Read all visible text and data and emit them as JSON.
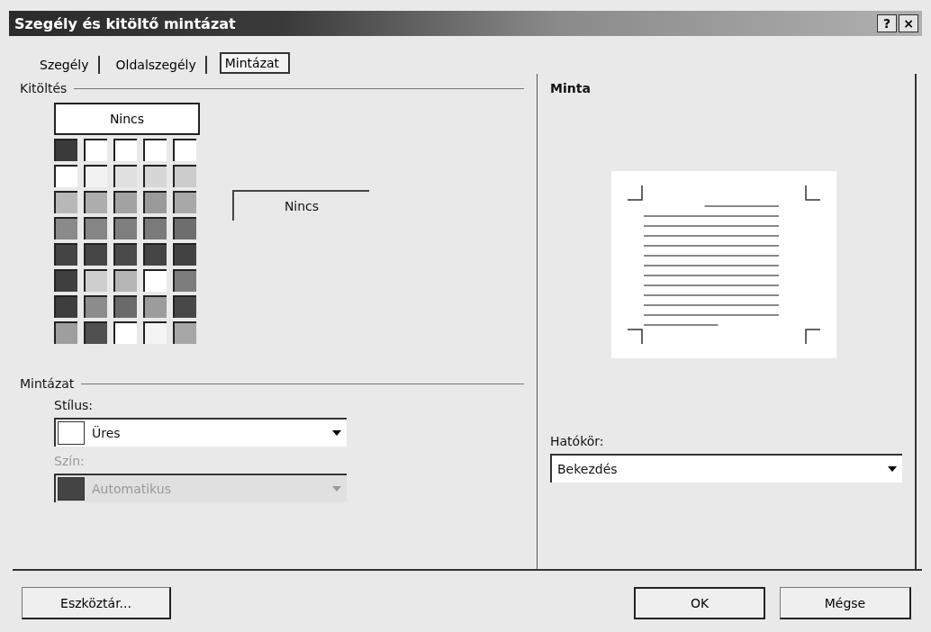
{
  "window": {
    "title": "Szegély és kitöltő mintázat",
    "help_button": "?",
    "close_button": "×"
  },
  "tabs": [
    {
      "label": "Szegély",
      "selected": false
    },
    {
      "label": "Oldalszegély",
      "selected": false
    },
    {
      "label": "Mintázat",
      "selected": true
    }
  ],
  "fill": {
    "label": "Kitöltés",
    "none_button": "Nincs",
    "preview_label": "Nincs",
    "swatches": [
      {
        "color": "#3a3a3a"
      },
      {
        "color": "#ffffff"
      },
      {
        "color": "#ffffff"
      },
      {
        "color": "#ffffff"
      },
      {
        "color": "#ffffff"
      },
      {
        "color": "#ffffff"
      },
      {
        "color": "#f2f2f2"
      },
      {
        "color": "#e0e0e0"
      },
      {
        "color": "#d6d6d6"
      },
      {
        "color": "#cccccc"
      },
      {
        "color": "#b8b8b8"
      },
      {
        "color": "#adadad"
      },
      {
        "color": "#a3a3a3"
      },
      {
        "color": "#9a9a9a"
      },
      {
        "color": "#a8a8a8"
      },
      {
        "color": "#8a8a8a"
      },
      {
        "color": "#858585"
      },
      {
        "color": "#7e7e7e"
      },
      {
        "color": "#7a7a7a"
      },
      {
        "color": "#6e6e6e"
      },
      {
        "color": "#444444"
      },
      {
        "color": "#464646"
      },
      {
        "color": "#4a4a4a"
      },
      {
        "color": "#454545"
      },
      {
        "color": "#424242"
      },
      {
        "color": "#404040"
      },
      {
        "color": "#cfcfcf"
      },
      {
        "color": "#b5b5b5"
      },
      {
        "color": "#ffffff"
      },
      {
        "color": "#7d7d7d"
      },
      {
        "color": "#3e3e3e"
      },
      {
        "color": "#8c8c8c"
      },
      {
        "color": "#6a6a6a"
      },
      {
        "color": "#9c9c9c"
      },
      {
        "color": "#484848"
      },
      {
        "color": "#9e9e9e"
      },
      {
        "color": "#505050"
      },
      {
        "color": "#ffffff"
      },
      {
        "color": "#f4f4f4"
      },
      {
        "color": "#a6a6a6"
      }
    ]
  },
  "pattern": {
    "label": "Mintázat",
    "style": {
      "label": "Stílus:",
      "value": "Üres",
      "disabled": false
    },
    "color": {
      "label": "Szín:",
      "value": "Automatikus",
      "disabled": true
    }
  },
  "preview": {
    "label": "Minta"
  },
  "scope": {
    "label": "Hatókör:",
    "value": "Bekezdés"
  },
  "buttons": [
    {
      "label": "Eszköztár...",
      "kind": "toolbar"
    },
    {
      "label": "OK",
      "kind": "ok"
    },
    {
      "label": "Mégse",
      "kind": "cancel"
    }
  ]
}
